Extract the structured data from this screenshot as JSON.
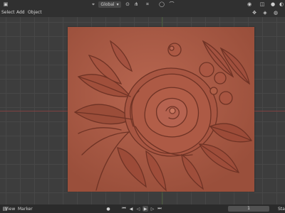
{
  "header": {
    "menus": [
      "Select",
      "Add",
      "Object"
    ],
    "orientation": "Global",
    "icons": [
      "transform-orientation-icon",
      "snap-icon",
      "snap-target-icon",
      "proportional-edit-icon",
      "falloff-icon",
      "overlay-icon",
      "shading-solid-icon"
    ]
  },
  "viewport": {
    "object_name": "floral-relief-panel",
    "relief_color": "#a45843"
  },
  "footer": {
    "view_label": "View",
    "marker_label": "Marker",
    "frame_current": "1",
    "start_label": "Sta"
  },
  "colors": {
    "grid": "#474747",
    "x_axis": "#7e4040",
    "background": "#3d3d3d",
    "header": "#303030"
  }
}
